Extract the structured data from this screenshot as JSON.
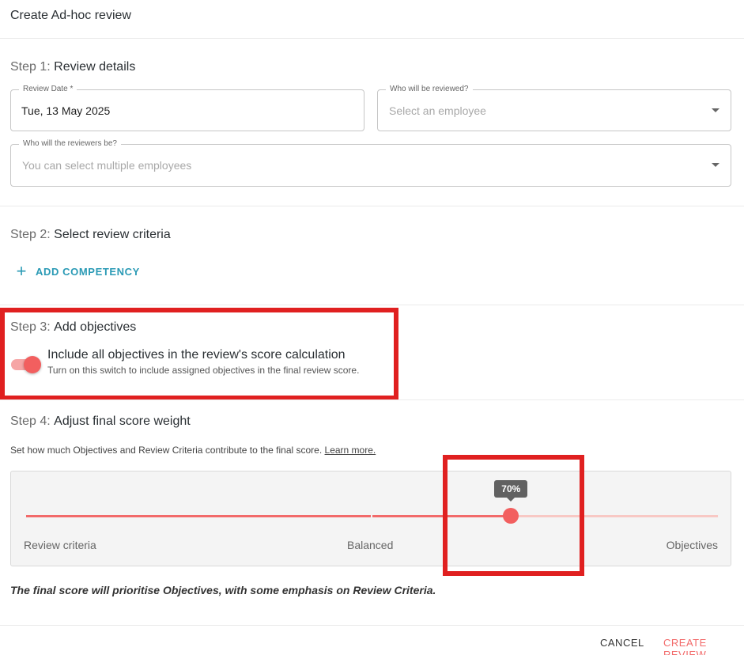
{
  "dialog": {
    "title": "Create Ad-hoc review"
  },
  "step1": {
    "prefix": "Step 1:",
    "title": "Review details",
    "review_date": {
      "label": "Review Date *",
      "value": "Tue, 13 May 2025"
    },
    "reviewee": {
      "label": "Who will be reviewed?",
      "placeholder": "Select an employee"
    },
    "reviewers": {
      "label": "Who will the reviewers be?",
      "placeholder": "You can select multiple employees"
    }
  },
  "step2": {
    "prefix": "Step 2:",
    "title": "Select review criteria",
    "add_competency_label": "ADD COMPETENCY"
  },
  "step3": {
    "prefix": "Step 3:",
    "title": "Add objectives",
    "toggle_on": true,
    "toggle_title": "Include all objectives in the review's score calculation",
    "toggle_subtitle": "Turn on this switch to include assigned objectives in the final review score."
  },
  "step4": {
    "prefix": "Step 4:",
    "title": "Adjust final score weight",
    "description": "Set how much Objectives and Review Criteria contribute to the final score.",
    "learn_more": "Learn more.",
    "slider": {
      "value_percent": 70,
      "value_label": "70%",
      "label_left": "Review criteria",
      "label_middle": "Balanced",
      "label_right": "Objectives"
    },
    "final_note": "The final score will prioritise Objectives, with some emphasis on Review Criteria."
  },
  "footer": {
    "cancel_label": "CANCEL",
    "create_label": "CREATE REVIEW"
  },
  "colors": {
    "accent_red": "#f25f5f",
    "link_teal": "#2a9ab5",
    "highlight_red": "#e02020"
  }
}
